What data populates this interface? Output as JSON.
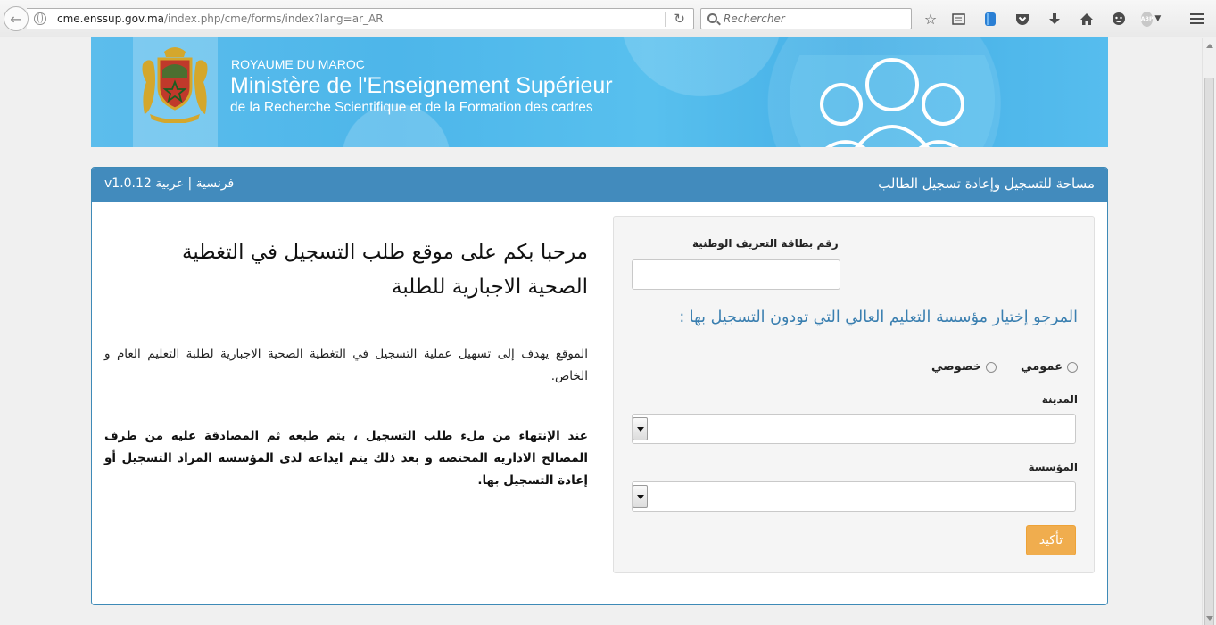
{
  "browser": {
    "url_host": "cme.enssup.gov.ma",
    "url_path": "/index.php/cme/forms/index?lang=ar_AR",
    "search_placeholder": "Rechercher",
    "abp_label": "ABP"
  },
  "banner": {
    "kingdom": "ROYAUME DU MAROC",
    "ministry": "Ministère de l'Enseignement Supérieur",
    "subtitle": "de la Recherche Scientifique et de la Formation des cadres"
  },
  "panel": {
    "title": "مساحة للتسجيل وإعادة تسجيل الطالب",
    "version": "v1.0.12",
    "lang_french": "فرنسية",
    "lang_separator": "|",
    "lang_arabic": "عربية"
  },
  "form": {
    "cin_label": "رقم بطاقة التعريف الوطنية",
    "cin_value": "",
    "choose_institution": "المرجو إختيار مؤسسة التعليم العالي التي تودون التسجيل بها :",
    "radio_public": "عمومي",
    "radio_private": "خصوصي",
    "city_label": "المدينة",
    "city_value": "",
    "institution_label": "المؤسسة",
    "institution_value": "",
    "confirm_label": "تأكيد"
  },
  "info": {
    "welcome": "مرحبا بكم على موقع طلب التسجيل في التغطية الصحية الاجبارية للطلبة",
    "description": "الموقع يهدف إلى تسهيل عملية التسجيل في التغطية الصحية الاجبارية لطلبة التعليم العام و الخاص.",
    "note": "عند الإنتهاء من ملء طلب التسجيل ، يتم طبعه ثم المصادقة عليه من طرف المصالح الادارية المختصة و بعد ذلك يتم ايداعه لدى المؤسسة المراد التسجيل أو إعادة التسجيل بها."
  },
  "colors": {
    "panel_header": "#428bbd",
    "accent_title": "#3a7fb0",
    "confirm_button": "#f0ad4e",
    "banner_blue": "#4db6ea"
  }
}
